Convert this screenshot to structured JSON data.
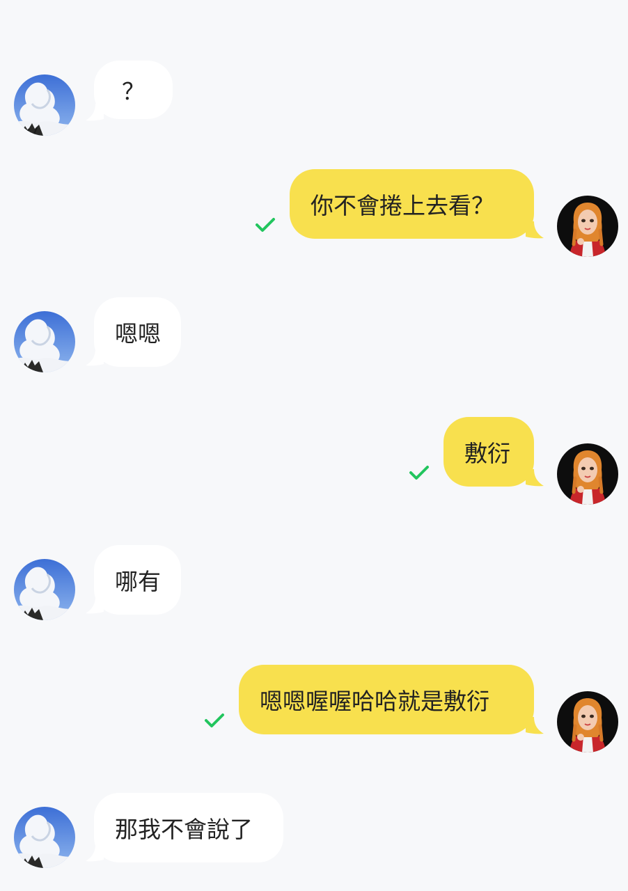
{
  "messages": [
    {
      "direction": "incoming",
      "text": "？",
      "avatar": "sky-cloud-avatar"
    },
    {
      "direction": "outgoing",
      "text": "你不會捲上去看？",
      "read": true,
      "avatar": "girl-avatar"
    },
    {
      "direction": "incoming",
      "text": "嗯嗯",
      "avatar": "sky-cloud-avatar"
    },
    {
      "direction": "outgoing",
      "text": "敷衍",
      "read": true,
      "avatar": "girl-avatar"
    },
    {
      "direction": "incoming",
      "text": "哪有",
      "avatar": "sky-cloud-avatar"
    },
    {
      "direction": "outgoing",
      "text": "嗯嗯喔喔哈哈就是敷衍",
      "read": true,
      "avatar": "girl-avatar"
    },
    {
      "direction": "incoming",
      "text": "那我不會說了",
      "avatar": "sky-cloud-avatar"
    }
  ],
  "colors": {
    "background": "#f7f8fa",
    "incoming_bubble": "#ffffff",
    "outgoing_bubble": "#f8e04e",
    "read_check": "#22c55e",
    "text": "#222222"
  }
}
